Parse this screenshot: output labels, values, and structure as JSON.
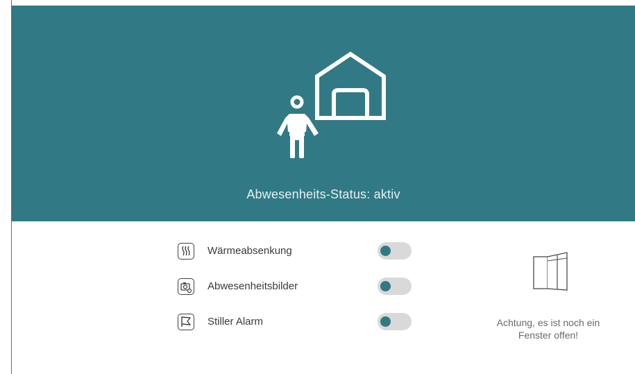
{
  "status": {
    "text": "Abwesenheits-Status: aktiv"
  },
  "settings": [
    {
      "icon": "heat-waves-icon",
      "label": "Wärmeabsenkung",
      "enabled": true
    },
    {
      "icon": "camera-images-icon",
      "label": "Abwesenheitsbilder",
      "enabled": true
    },
    {
      "icon": "flag-icon",
      "label": "Stiller Alarm",
      "enabled": true
    }
  ],
  "window_warning": {
    "icon": "open-window-icon",
    "line1": "Achtung, es ist noch ein",
    "line2": "Fenster offen!"
  },
  "colors": {
    "accent": "#317985",
    "toggle_track": "#d9d9d9",
    "background": "#ffffff"
  }
}
